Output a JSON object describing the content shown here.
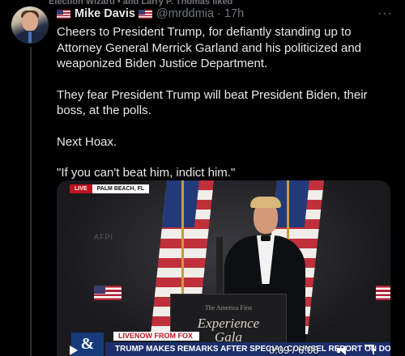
{
  "retweet_context": {
    "text": "Election Wizard • and Larry P. Thomas liked"
  },
  "tweet": {
    "author_name": "Mike Davis",
    "handle": "@mrddmia",
    "separator": "·",
    "timestamp": "17h",
    "more_label": "···",
    "paragraphs": [
      "Cheers to President Trump, for defiantly standing up to Attorney General Merrick Garland and his politicized and weaponized Biden Justice Department.",
      "They fear President Trump will beat President Biden, their boss, at the polls.",
      "Next Hoax.",
      "\"If you can't beat him, indict him.\""
    ]
  },
  "video": {
    "live_label": "LIVE",
    "location": "PALM BEACH, FL",
    "logo_text": "AFPI",
    "podium_small": "The America First",
    "podium_line1": "Experience",
    "podium_line2": "Gala",
    "network_tag": "LIVENOW FROM FOX",
    "network_logo": "&",
    "headline": "TRUMP MAKES REMARKS AFTER SPECIAL COUNSEL REPORT ON DOC PROBE",
    "time_display": "0:09 / 6:00"
  },
  "colors": {
    "background": "#000000",
    "text": "#e7e9ea",
    "muted": "#71767b",
    "live_red": "#c1121f",
    "chyron_blue": "#1b2d6b"
  }
}
